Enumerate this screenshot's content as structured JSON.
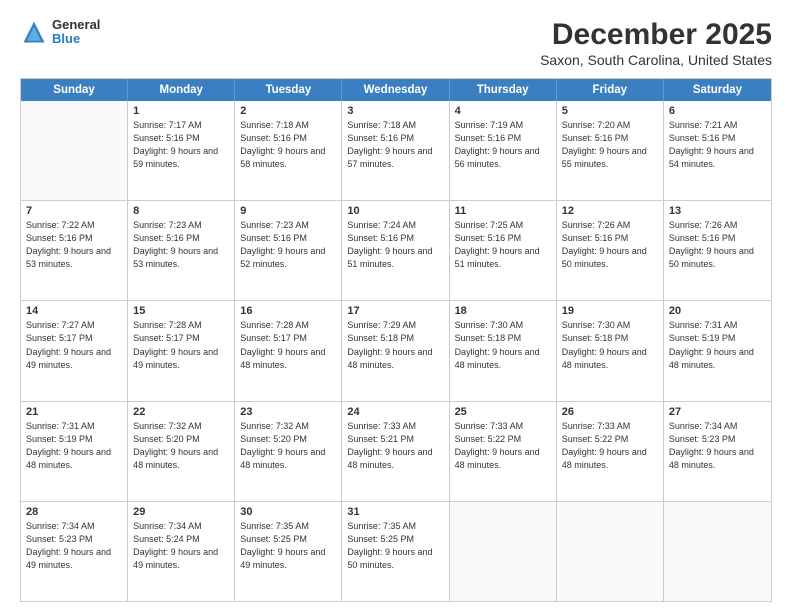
{
  "header": {
    "logo_general": "General",
    "logo_blue": "Blue",
    "main_title": "December 2025",
    "subtitle": "Saxon, South Carolina, United States"
  },
  "calendar": {
    "days_of_week": [
      "Sunday",
      "Monday",
      "Tuesday",
      "Wednesday",
      "Thursday",
      "Friday",
      "Saturday"
    ],
    "weeks": [
      [
        {
          "day": "",
          "empty": true
        },
        {
          "day": "1",
          "sunrise": "Sunrise: 7:17 AM",
          "sunset": "Sunset: 5:16 PM",
          "daylight": "Daylight: 9 hours and 59 minutes."
        },
        {
          "day": "2",
          "sunrise": "Sunrise: 7:18 AM",
          "sunset": "Sunset: 5:16 PM",
          "daylight": "Daylight: 9 hours and 58 minutes."
        },
        {
          "day": "3",
          "sunrise": "Sunrise: 7:18 AM",
          "sunset": "Sunset: 5:16 PM",
          "daylight": "Daylight: 9 hours and 57 minutes."
        },
        {
          "day": "4",
          "sunrise": "Sunrise: 7:19 AM",
          "sunset": "Sunset: 5:16 PM",
          "daylight": "Daylight: 9 hours and 56 minutes."
        },
        {
          "day": "5",
          "sunrise": "Sunrise: 7:20 AM",
          "sunset": "Sunset: 5:16 PM",
          "daylight": "Daylight: 9 hours and 55 minutes."
        },
        {
          "day": "6",
          "sunrise": "Sunrise: 7:21 AM",
          "sunset": "Sunset: 5:16 PM",
          "daylight": "Daylight: 9 hours and 54 minutes."
        }
      ],
      [
        {
          "day": "7",
          "sunrise": "Sunrise: 7:22 AM",
          "sunset": "Sunset: 5:16 PM",
          "daylight": "Daylight: 9 hours and 53 minutes."
        },
        {
          "day": "8",
          "sunrise": "Sunrise: 7:23 AM",
          "sunset": "Sunset: 5:16 PM",
          "daylight": "Daylight: 9 hours and 53 minutes."
        },
        {
          "day": "9",
          "sunrise": "Sunrise: 7:23 AM",
          "sunset": "Sunset: 5:16 PM",
          "daylight": "Daylight: 9 hours and 52 minutes."
        },
        {
          "day": "10",
          "sunrise": "Sunrise: 7:24 AM",
          "sunset": "Sunset: 5:16 PM",
          "daylight": "Daylight: 9 hours and 51 minutes."
        },
        {
          "day": "11",
          "sunrise": "Sunrise: 7:25 AM",
          "sunset": "Sunset: 5:16 PM",
          "daylight": "Daylight: 9 hours and 51 minutes."
        },
        {
          "day": "12",
          "sunrise": "Sunrise: 7:26 AM",
          "sunset": "Sunset: 5:16 PM",
          "daylight": "Daylight: 9 hours and 50 minutes."
        },
        {
          "day": "13",
          "sunrise": "Sunrise: 7:26 AM",
          "sunset": "Sunset: 5:16 PM",
          "daylight": "Daylight: 9 hours and 50 minutes."
        }
      ],
      [
        {
          "day": "14",
          "sunrise": "Sunrise: 7:27 AM",
          "sunset": "Sunset: 5:17 PM",
          "daylight": "Daylight: 9 hours and 49 minutes."
        },
        {
          "day": "15",
          "sunrise": "Sunrise: 7:28 AM",
          "sunset": "Sunset: 5:17 PM",
          "daylight": "Daylight: 9 hours and 49 minutes."
        },
        {
          "day": "16",
          "sunrise": "Sunrise: 7:28 AM",
          "sunset": "Sunset: 5:17 PM",
          "daylight": "Daylight: 9 hours and 48 minutes."
        },
        {
          "day": "17",
          "sunrise": "Sunrise: 7:29 AM",
          "sunset": "Sunset: 5:18 PM",
          "daylight": "Daylight: 9 hours and 48 minutes."
        },
        {
          "day": "18",
          "sunrise": "Sunrise: 7:30 AM",
          "sunset": "Sunset: 5:18 PM",
          "daylight": "Daylight: 9 hours and 48 minutes."
        },
        {
          "day": "19",
          "sunrise": "Sunrise: 7:30 AM",
          "sunset": "Sunset: 5:18 PM",
          "daylight": "Daylight: 9 hours and 48 minutes."
        },
        {
          "day": "20",
          "sunrise": "Sunrise: 7:31 AM",
          "sunset": "Sunset: 5:19 PM",
          "daylight": "Daylight: 9 hours and 48 minutes."
        }
      ],
      [
        {
          "day": "21",
          "sunrise": "Sunrise: 7:31 AM",
          "sunset": "Sunset: 5:19 PM",
          "daylight": "Daylight: 9 hours and 48 minutes."
        },
        {
          "day": "22",
          "sunrise": "Sunrise: 7:32 AM",
          "sunset": "Sunset: 5:20 PM",
          "daylight": "Daylight: 9 hours and 48 minutes."
        },
        {
          "day": "23",
          "sunrise": "Sunrise: 7:32 AM",
          "sunset": "Sunset: 5:20 PM",
          "daylight": "Daylight: 9 hours and 48 minutes."
        },
        {
          "day": "24",
          "sunrise": "Sunrise: 7:33 AM",
          "sunset": "Sunset: 5:21 PM",
          "daylight": "Daylight: 9 hours and 48 minutes."
        },
        {
          "day": "25",
          "sunrise": "Sunrise: 7:33 AM",
          "sunset": "Sunset: 5:22 PM",
          "daylight": "Daylight: 9 hours and 48 minutes."
        },
        {
          "day": "26",
          "sunrise": "Sunrise: 7:33 AM",
          "sunset": "Sunset: 5:22 PM",
          "daylight": "Daylight: 9 hours and 48 minutes."
        },
        {
          "day": "27",
          "sunrise": "Sunrise: 7:34 AM",
          "sunset": "Sunset: 5:23 PM",
          "daylight": "Daylight: 9 hours and 48 minutes."
        }
      ],
      [
        {
          "day": "28",
          "sunrise": "Sunrise: 7:34 AM",
          "sunset": "Sunset: 5:23 PM",
          "daylight": "Daylight: 9 hours and 49 minutes."
        },
        {
          "day": "29",
          "sunrise": "Sunrise: 7:34 AM",
          "sunset": "Sunset: 5:24 PM",
          "daylight": "Daylight: 9 hours and 49 minutes."
        },
        {
          "day": "30",
          "sunrise": "Sunrise: 7:35 AM",
          "sunset": "Sunset: 5:25 PM",
          "daylight": "Daylight: 9 hours and 49 minutes."
        },
        {
          "day": "31",
          "sunrise": "Sunrise: 7:35 AM",
          "sunset": "Sunset: 5:25 PM",
          "daylight": "Daylight: 9 hours and 50 minutes."
        },
        {
          "day": "",
          "empty": true
        },
        {
          "day": "",
          "empty": true
        },
        {
          "day": "",
          "empty": true
        }
      ]
    ]
  }
}
